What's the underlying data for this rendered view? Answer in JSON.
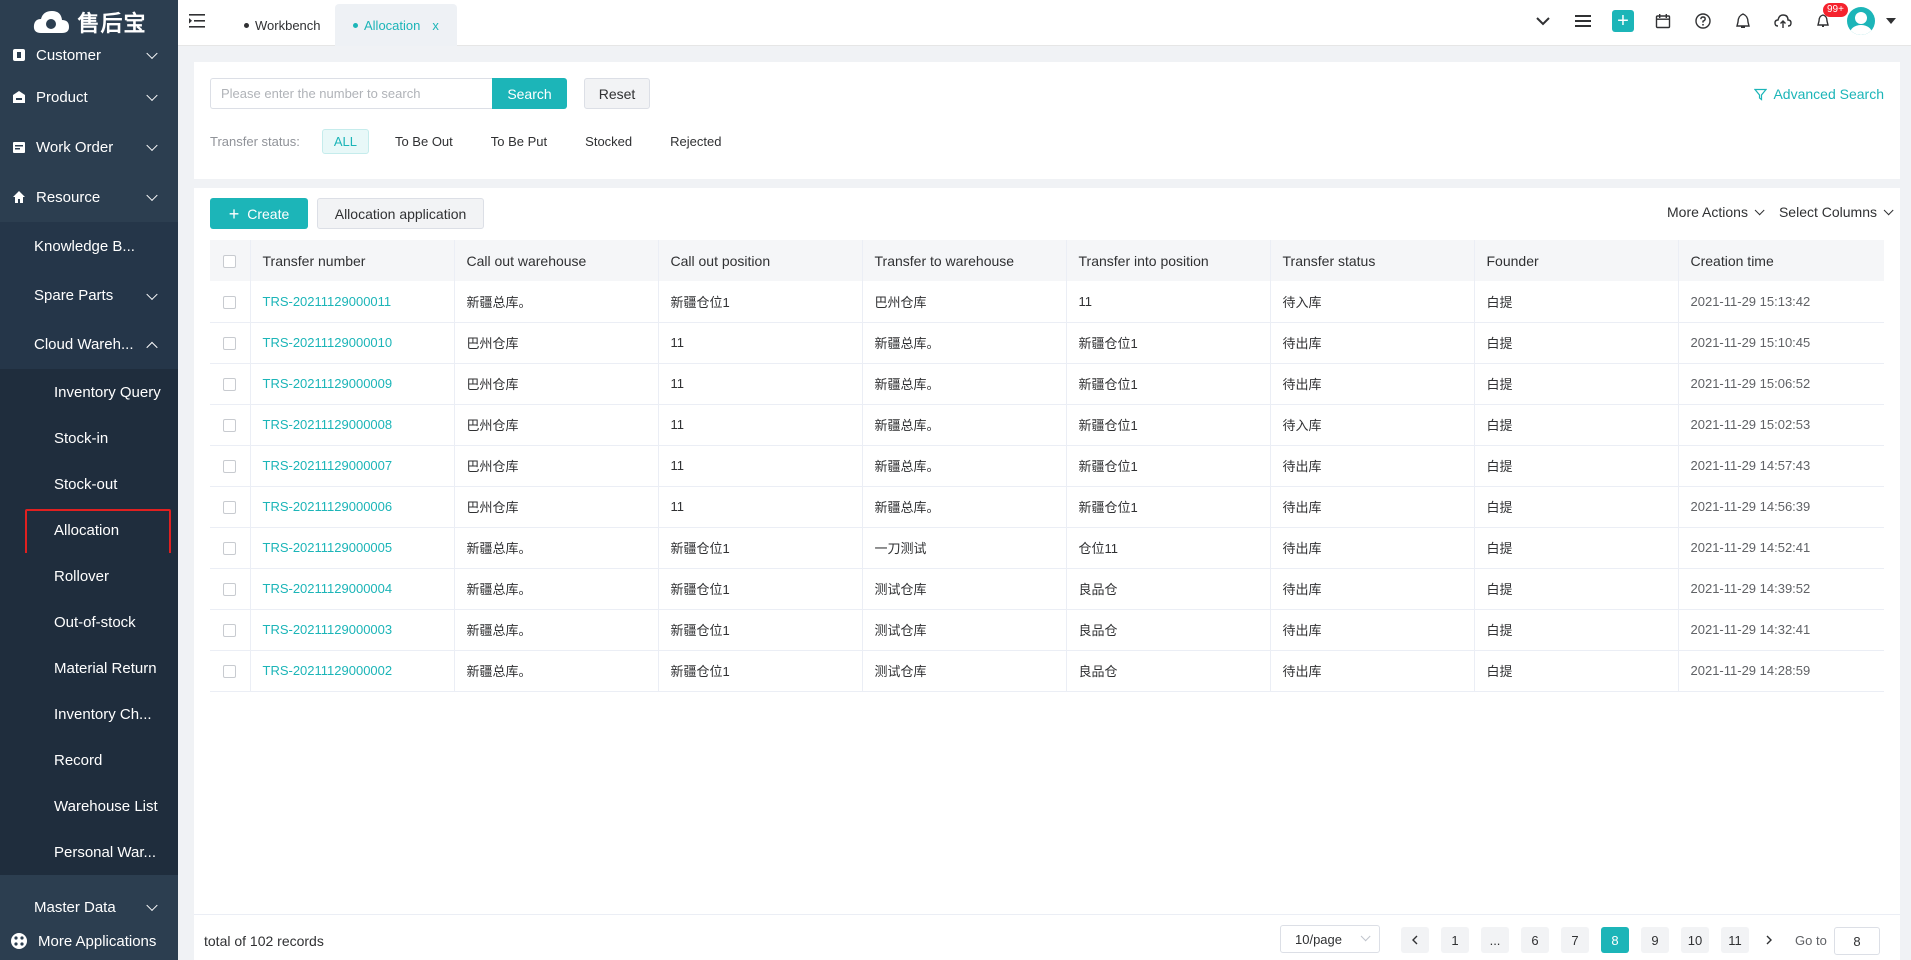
{
  "app": {
    "logo_text": "售后宝"
  },
  "sidebar": {
    "items": [
      {
        "label": "Customer"
      },
      {
        "label": "Product"
      },
      {
        "label": "Work Order"
      },
      {
        "label": "Resource"
      }
    ],
    "sub_items": [
      {
        "label": "Knowledge B..."
      },
      {
        "label": "Spare Parts"
      },
      {
        "label": "Cloud Wareh..."
      }
    ],
    "leaves": [
      {
        "label": "Inventory Query"
      },
      {
        "label": "Stock-in"
      },
      {
        "label": "Stock-out"
      },
      {
        "label": "Allocation"
      },
      {
        "label": "Rollover"
      },
      {
        "label": "Out-of-stock"
      },
      {
        "label": "Material Return"
      },
      {
        "label": "Inventory Ch..."
      },
      {
        "label": "Record"
      },
      {
        "label": "Warehouse List"
      },
      {
        "label": "Personal War..."
      }
    ],
    "master_data": "Master Data",
    "more_apps": "More Applications"
  },
  "tabs": [
    {
      "label": "Workbench"
    },
    {
      "label": "Allocation",
      "close": "x"
    }
  ],
  "topbar": {
    "badge": "99+"
  },
  "search": {
    "placeholder": "Please enter the number to search",
    "search_label": "Search",
    "reset_label": "Reset",
    "advanced_label": "Advanced Search",
    "status_label": "Transfer status:",
    "status_options": [
      "ALL",
      "To Be Out",
      "To Be Put",
      "Stocked",
      "Rejected"
    ]
  },
  "toolbar": {
    "create_label": "Create",
    "allocation_label": "Allocation application",
    "more_actions": "More Actions",
    "select_columns": "Select Columns"
  },
  "table": {
    "columns": [
      "Transfer number",
      "Call out warehouse",
      "Call out position",
      "Transfer to warehouse",
      "Transfer into position",
      "Transfer status",
      "Founder",
      "Creation time"
    ],
    "rows": [
      [
        "TRS-20211129000011",
        "新疆总库。",
        "新疆仓位1",
        "巴州仓库",
        "11",
        "待入库",
        "白提",
        "2021-11-29 15:13:42"
      ],
      [
        "TRS-20211129000010",
        "巴州仓库",
        "11",
        "新疆总库。",
        "新疆仓位1",
        "待出库",
        "白提",
        "2021-11-29 15:10:45"
      ],
      [
        "TRS-20211129000009",
        "巴州仓库",
        "11",
        "新疆总库。",
        "新疆仓位1",
        "待出库",
        "白提",
        "2021-11-29 15:06:52"
      ],
      [
        "TRS-20211129000008",
        "巴州仓库",
        "11",
        "新疆总库。",
        "新疆仓位1",
        "待入库",
        "白提",
        "2021-11-29 15:02:53"
      ],
      [
        "TRS-20211129000007",
        "巴州仓库",
        "11",
        "新疆总库。",
        "新疆仓位1",
        "待出库",
        "白提",
        "2021-11-29 14:57:43"
      ],
      [
        "TRS-20211129000006",
        "巴州仓库",
        "11",
        "新疆总库。",
        "新疆仓位1",
        "待出库",
        "白提",
        "2021-11-29 14:56:39"
      ],
      [
        "TRS-20211129000005",
        "新疆总库。",
        "新疆仓位1",
        "一刀测试",
        "仓位11",
        "待出库",
        "白提",
        "2021-11-29 14:52:41"
      ],
      [
        "TRS-20211129000004",
        "新疆总库。",
        "新疆仓位1",
        "测试仓库",
        "良品仓",
        "待出库",
        "白提",
        "2021-11-29 14:39:52"
      ],
      [
        "TRS-20211129000003",
        "新疆总库。",
        "新疆仓位1",
        "测试仓库",
        "良品仓",
        "待出库",
        "白提",
        "2021-11-29 14:32:41"
      ],
      [
        "TRS-20211129000002",
        "新疆总库。",
        "新疆仓位1",
        "测试仓库",
        "良品仓",
        "待出库",
        "白提",
        "2021-11-29 14:28:59"
      ]
    ]
  },
  "pagination": {
    "total_text": "total of 102 records",
    "page_size": "10/page",
    "pages": [
      "1",
      "...",
      "6",
      "7",
      "8",
      "9",
      "10",
      "11"
    ],
    "current": "8",
    "goto_label": "Go to",
    "goto_value": "8"
  },
  "colors": {
    "accent": "#1cb5b8",
    "sidebar": "#2c3e50",
    "highlight_box": "#e02020"
  }
}
